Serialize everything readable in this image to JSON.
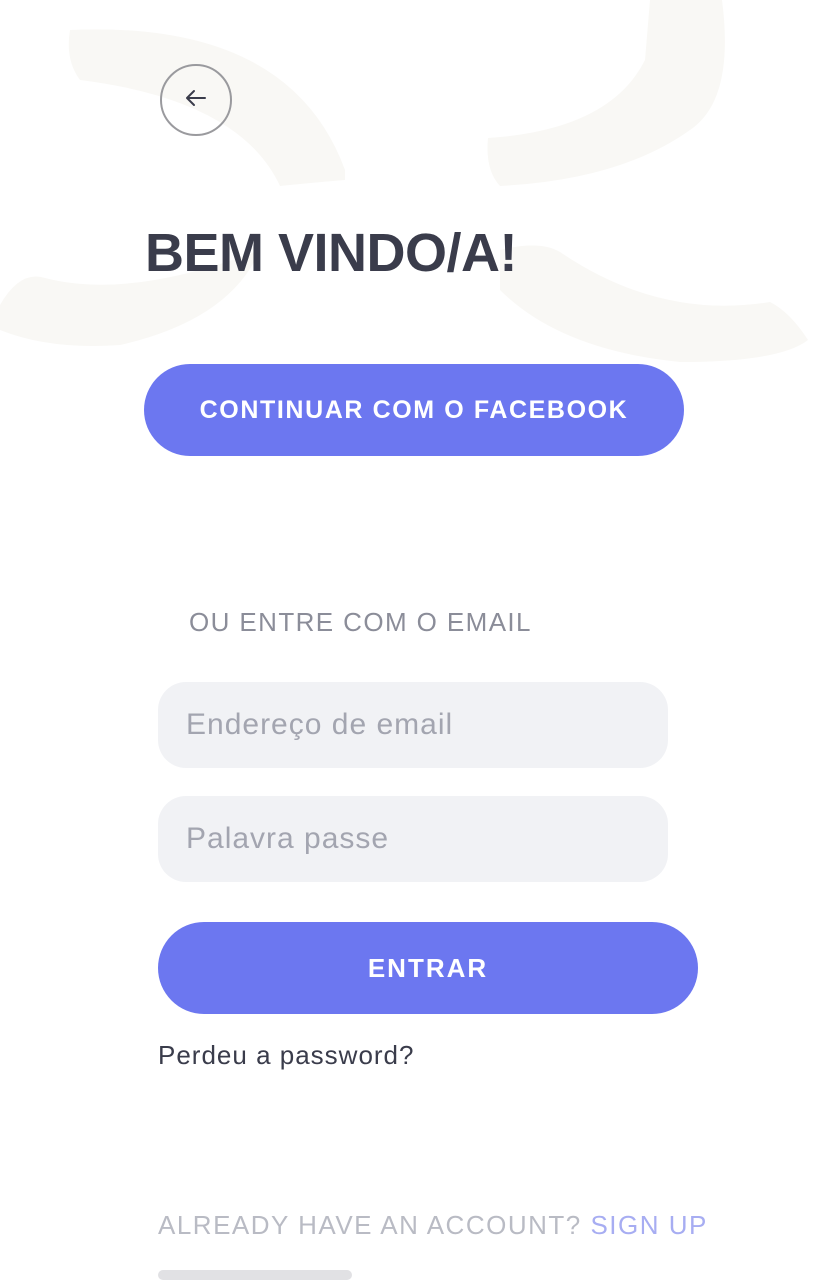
{
  "header": {
    "back_icon": "arrow-left-icon",
    "title": "BEM VINDO/A!"
  },
  "social": {
    "facebook_label": "CONTINUAR COM O FACEBOOK"
  },
  "email_login": {
    "divider_label": "OU ENTRE COM O EMAIL",
    "email_placeholder": "Endereço de email",
    "email_value": "",
    "password_placeholder": "Palavra passe",
    "password_value": "",
    "submit_label": "ENTRAR",
    "forgot_label": "Perdeu a password?"
  },
  "footer": {
    "text": "ALREADY HAVE AN ACCOUNT? ",
    "link_label": "SIGN UP"
  },
  "colors": {
    "accent": "#6c77f0",
    "title": "#3a3c4b",
    "input_bg": "#f1f2f5",
    "decor": "#f9f8f5"
  }
}
